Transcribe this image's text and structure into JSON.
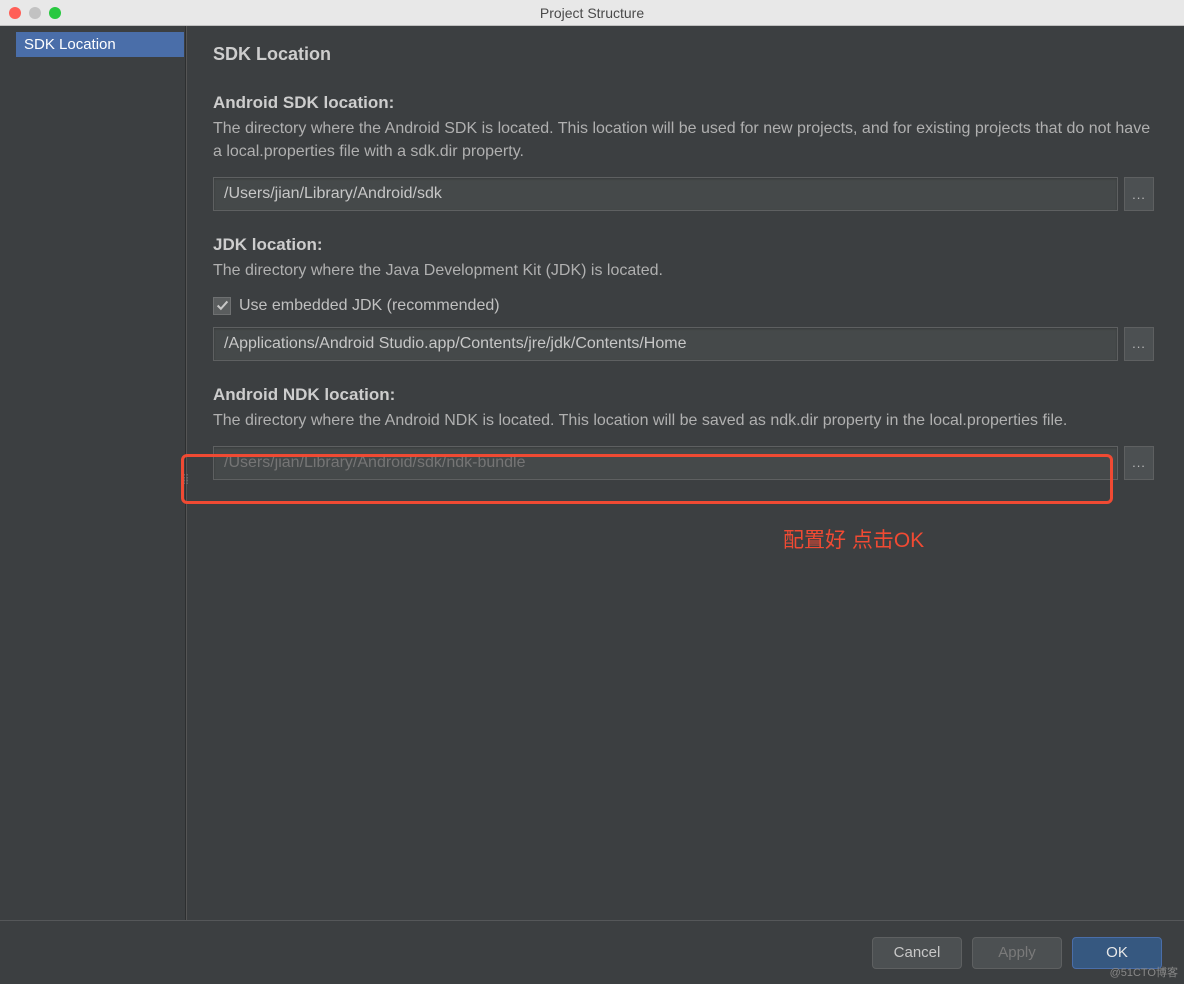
{
  "window": {
    "title": "Project Structure"
  },
  "sidebar": {
    "items": [
      {
        "label": "SDK Location",
        "selected": true
      }
    ]
  },
  "content": {
    "heading": "SDK Location",
    "sdk": {
      "label": "Android SDK location:",
      "desc": "The directory where the Android SDK is located. This location will be used for new projects, and for existing projects that do not have a local.properties file with a sdk.dir property.",
      "value": "/Users/jian/Library/Android/sdk",
      "browse": "..."
    },
    "jdk": {
      "label": "JDK location:",
      "desc": "The directory where the Java Development Kit (JDK) is located.",
      "checkbox_label": "Use embedded JDK (recommended)",
      "checked": true,
      "value": "/Applications/Android Studio.app/Contents/jre/jdk/Contents/Home",
      "browse": "..."
    },
    "ndk": {
      "label": "Android NDK location:",
      "desc": "The directory where the Android NDK is located. This location will be saved as ndk.dir property in the local.properties file.",
      "placeholder": "/Users/jian/Library/Android/sdk/ndk-bundle",
      "browse": "..."
    },
    "annotation": "配置好 点击OK"
  },
  "footer": {
    "cancel": "Cancel",
    "apply": "Apply",
    "ok": "OK"
  },
  "watermark": "@51CTO博客"
}
